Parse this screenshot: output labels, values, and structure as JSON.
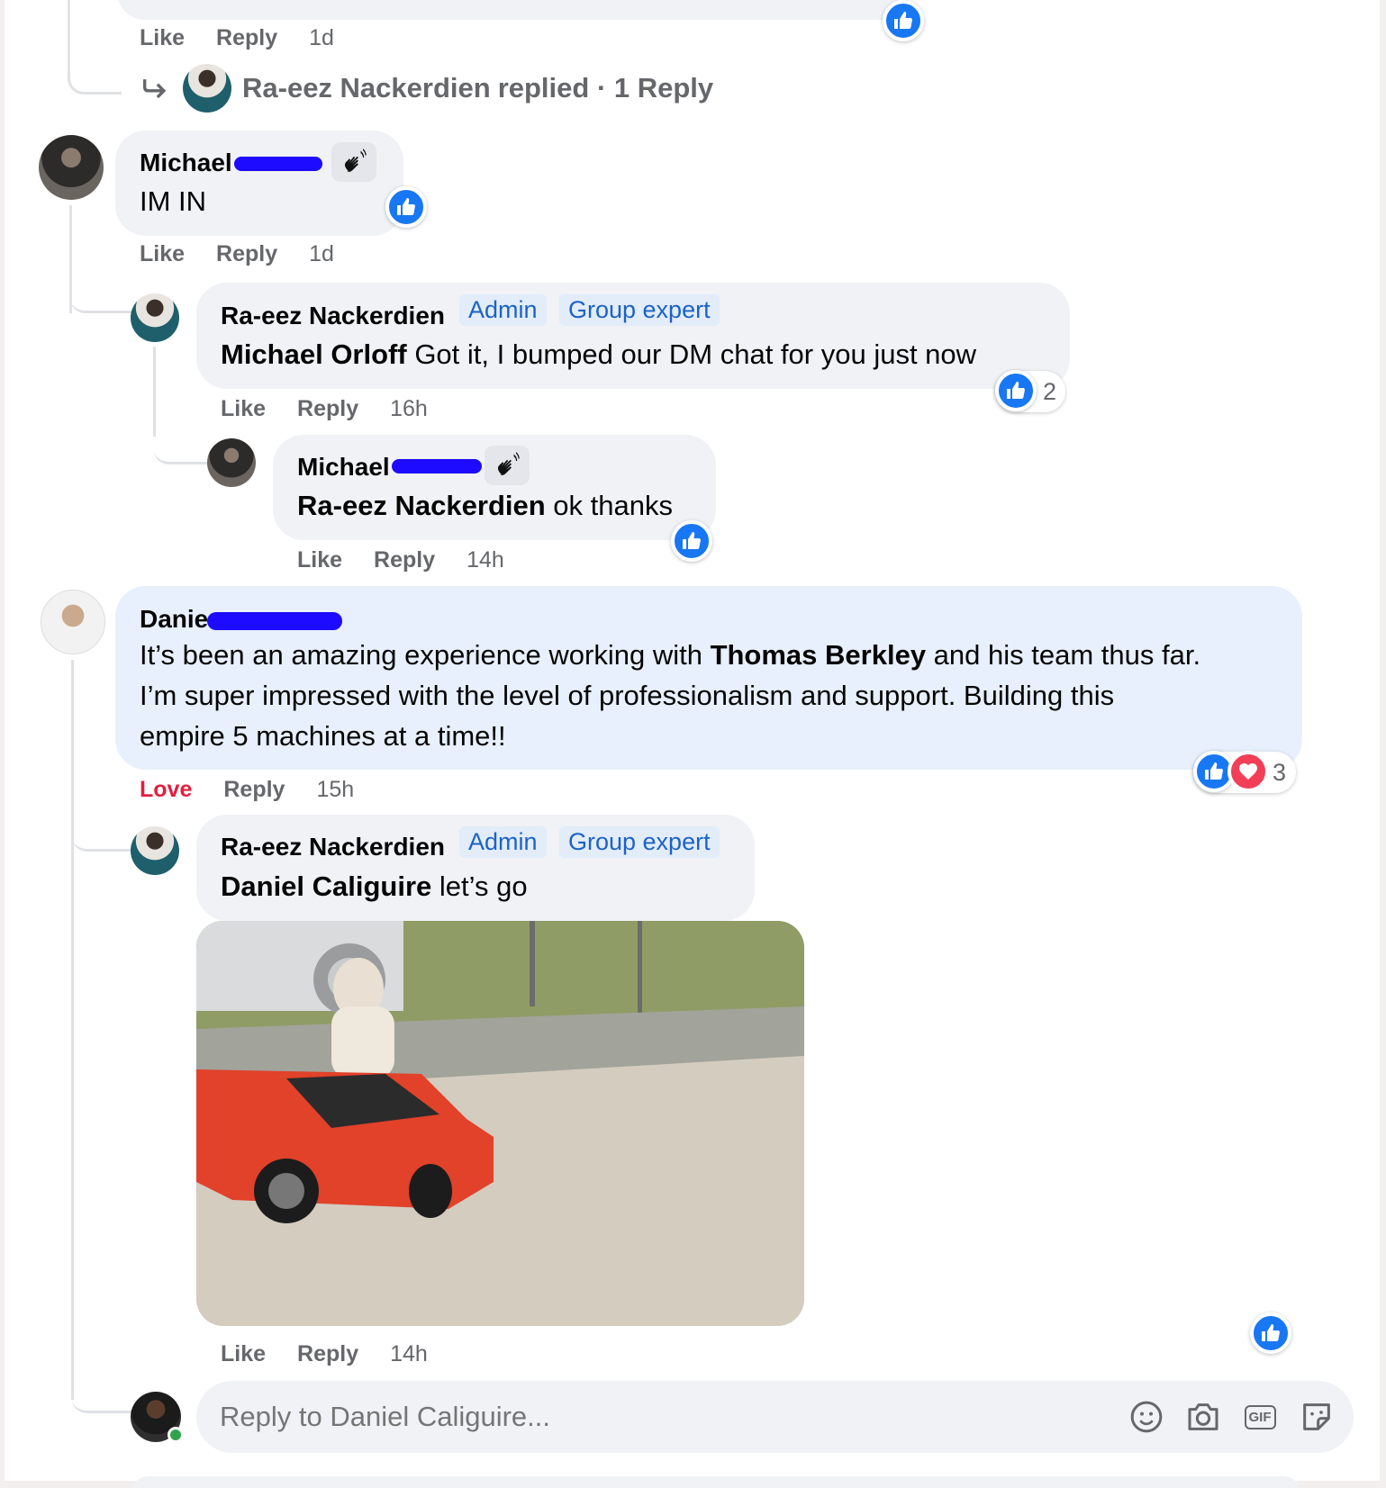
{
  "top_fragment": {
    "like": "Like",
    "reply": "Reply",
    "time": "1d",
    "replied_link": {
      "name": "Ra-eez Nackerdien",
      "suffix": "replied · 1 Reply"
    }
  },
  "comments": [
    {
      "author": "Michael",
      "text": "IM IN",
      "like": "Like",
      "reply": "Reply",
      "time": "1d"
    },
    {
      "author": "Ra-eez Nackerdien",
      "badges": [
        "Admin",
        "Group expert"
      ],
      "mention": "Michael Orloff",
      "text": " Got it, I bumped our DM chat for you just now",
      "like": "Like",
      "reply": "Reply",
      "time": "16h",
      "reaction_count": "2"
    },
    {
      "author": "Michael",
      "mention": "Ra-eez Nackerdien",
      "text": " ok thanks",
      "like": "Like",
      "reply": "Reply",
      "time": "14h"
    },
    {
      "author": "Danie",
      "line1_a": "It’s been an amazing experience working with ",
      "line1_mention": "Thomas Berkley",
      "line1_b": " and his team thus far.",
      "line2": "I’m super impressed with the level of professionalism and support. Building this",
      "line3": "empire 5 machines at a time!!",
      "love": "Love",
      "reply": "Reply",
      "time": "15h",
      "reaction_count": "3"
    },
    {
      "author": "Ra-eez Nackerdien",
      "badges": [
        "Admin",
        "Group expert"
      ],
      "mention": "Daniel Caliguire",
      "text": " let’s go",
      "like": "Like",
      "reply": "Reply",
      "time": "14h"
    }
  ],
  "composer": {
    "placeholder": "Reply to Daniel Caliguire...",
    "icons": [
      "emoji-icon",
      "camera-icon",
      "gif-icon",
      "sticker-icon"
    ],
    "gif_label": "GIF"
  },
  "colors": {
    "like_blue": "#1877f2",
    "love_red": "#e41e3f",
    "badge_blue": "#1b63c5",
    "bubble_gray": "#f0f2f5",
    "bubble_highlight": "#e7f0fc"
  }
}
